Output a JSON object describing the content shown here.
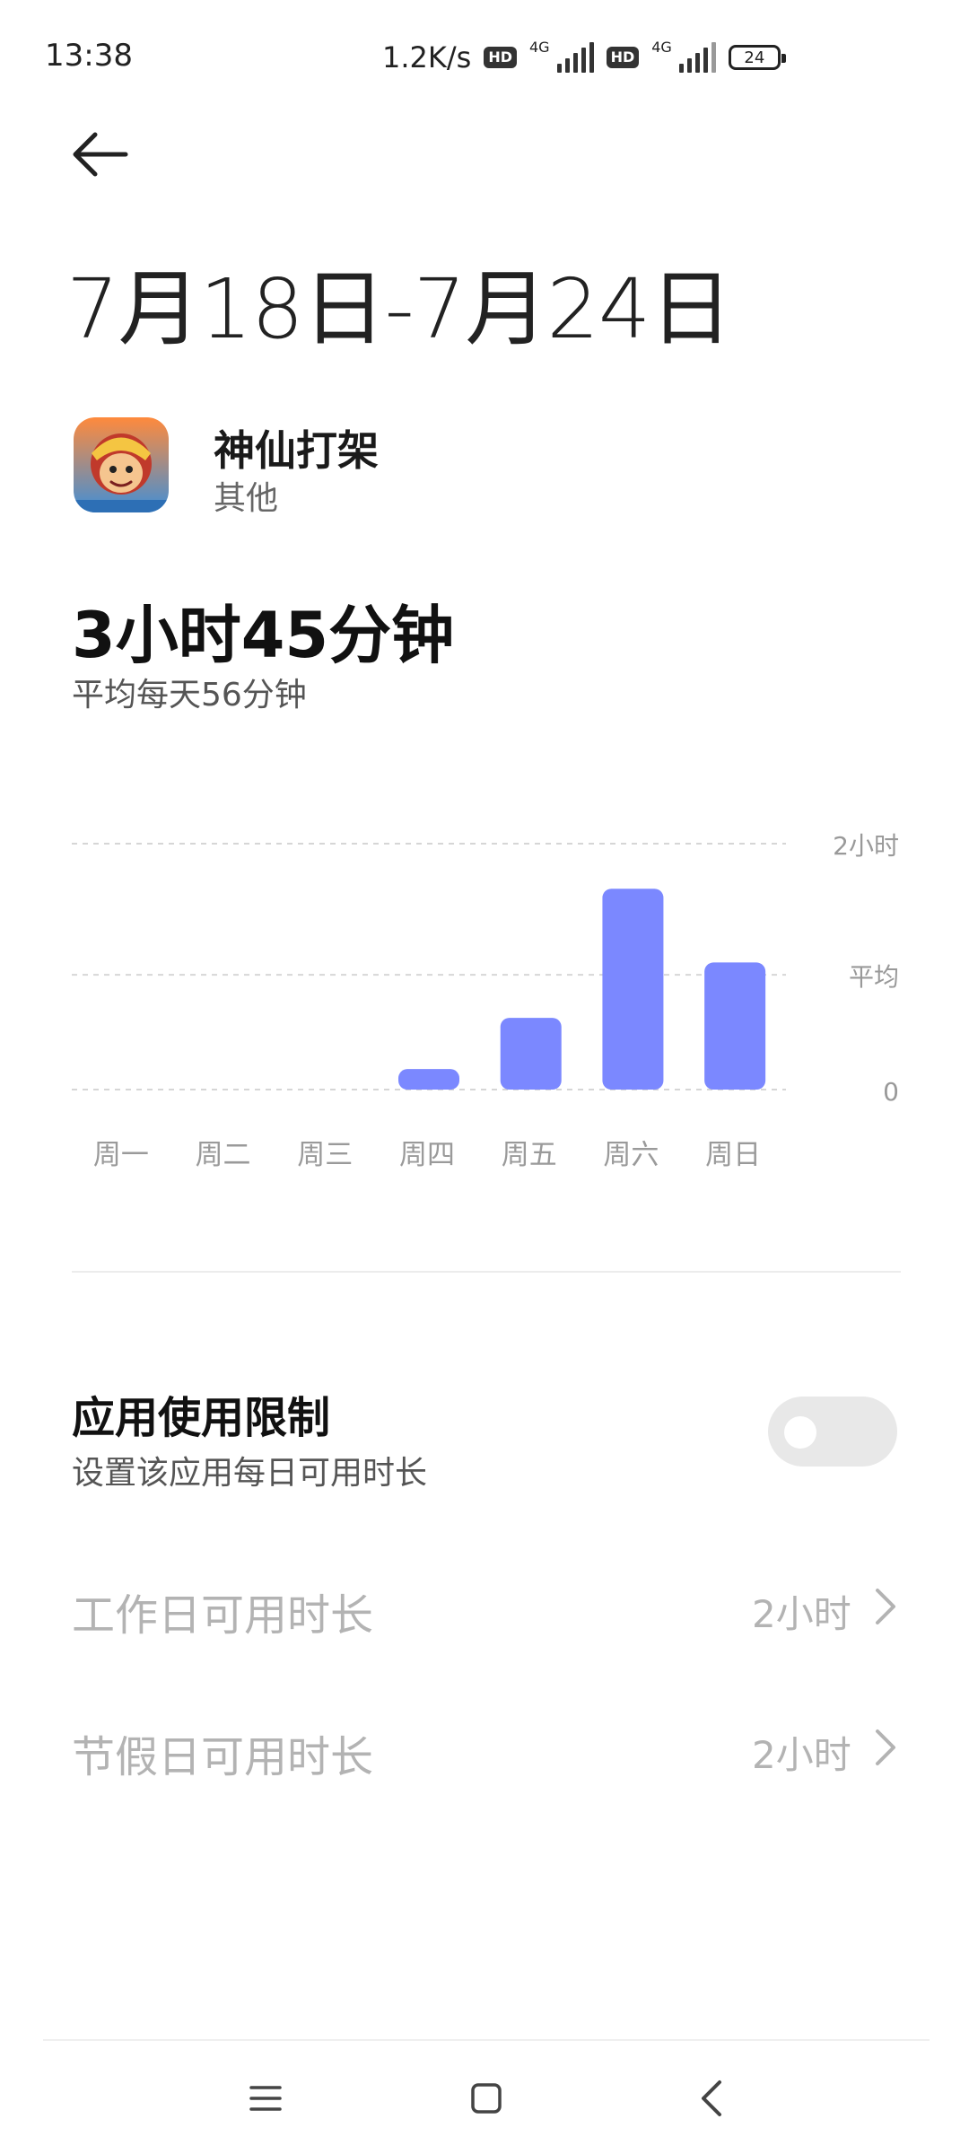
{
  "status_bar": {
    "time": "13:38",
    "speed": "1.2K/s",
    "sim1": {
      "badge": "HD",
      "network": "4G"
    },
    "sim2": {
      "badge": "HD",
      "network": "4G"
    },
    "battery": "24"
  },
  "header": {
    "back_icon": "arrow-left-icon",
    "date_range": "7月18日-7月24日"
  },
  "app": {
    "name": "神仙打架",
    "category": "其他"
  },
  "summary": {
    "total": "3小时45分钟",
    "average": "平均每天56分钟"
  },
  "chart_data": {
    "type": "bar",
    "categories": [
      "周一",
      "周二",
      "周三",
      "周四",
      "周五",
      "周六",
      "周日"
    ],
    "values": [
      0,
      0,
      0,
      10,
      35,
      98,
      62
    ],
    "unit": "分钟",
    "ylim": [
      0,
      120
    ],
    "y_tick_labels": [
      {
        "label": "2小时",
        "value": 120
      },
      {
        "label": "平均",
        "value": 56
      },
      {
        "label": "0",
        "value": 0
      }
    ],
    "grid": true,
    "bar_color": "#7b88ff"
  },
  "limit": {
    "title": "应用使用限制",
    "subtitle": "设置该应用每日可用时长",
    "enabled": false,
    "workday": {
      "label": "工作日可用时长",
      "value": "2小时"
    },
    "holiday": {
      "label": "节假日可用时长",
      "value": "2小时"
    }
  },
  "nav_bar": {
    "menu_icon": "menu-icon",
    "home_icon": "home-icon",
    "back_icon": "back-icon"
  },
  "colors": {
    "accent": "#7b88ff",
    "disabled_text": "#b3b3b3",
    "toggle_off": "#e8e8e8"
  }
}
